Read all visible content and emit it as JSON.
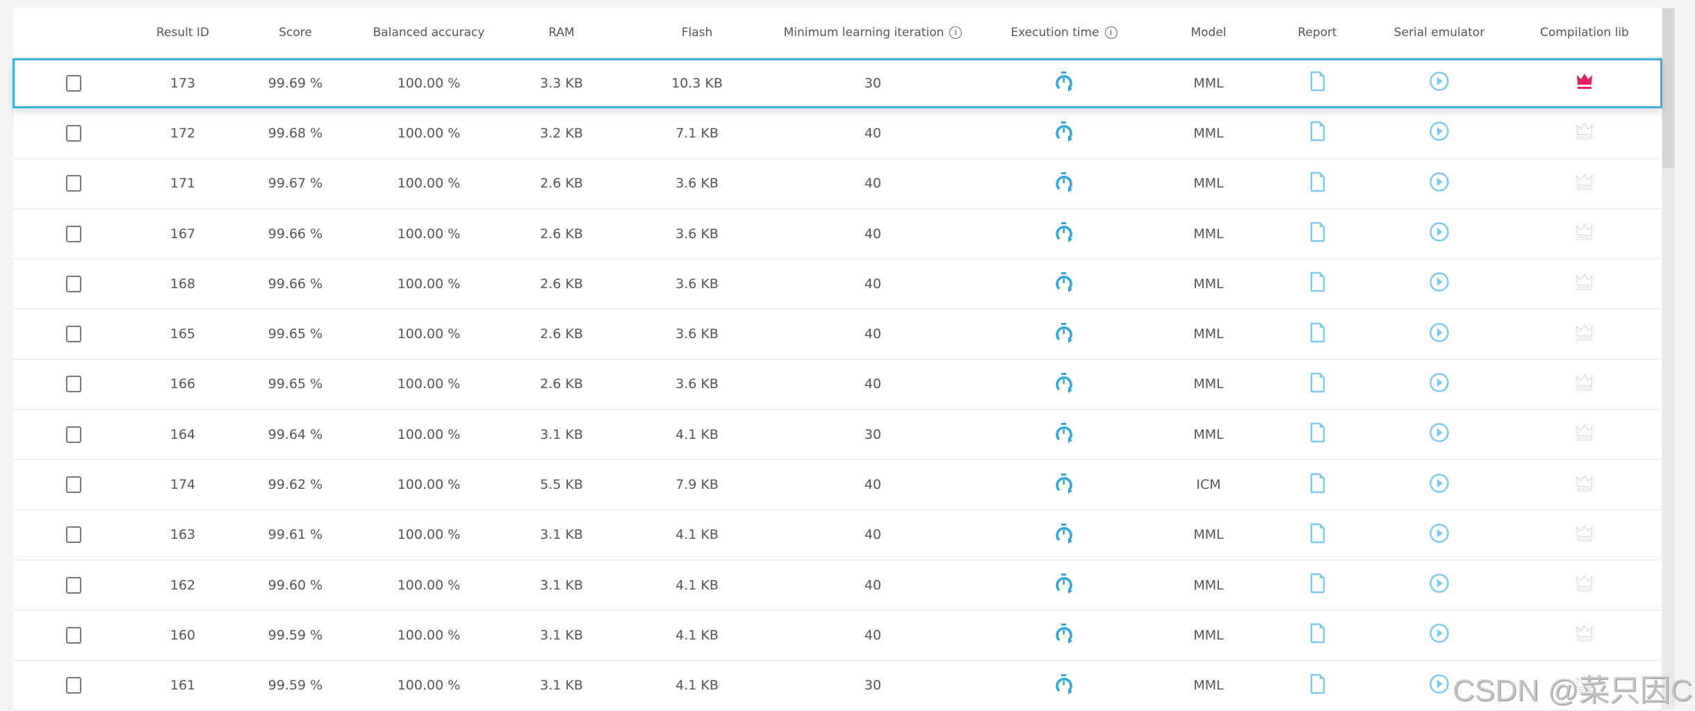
{
  "colors": {
    "accent": "#3ab0e0",
    "crown_active": "#e91e63",
    "crown_inactive": "#bbbbbb",
    "icon_blue": "#7ccbef",
    "stopwatch": "#2aa7dc"
  },
  "headers": [
    "",
    "Result ID",
    "Score",
    "Balanced accuracy",
    "RAM",
    "Flash",
    "Minimum learning iteration",
    "Execution time",
    "Model",
    "Report",
    "Serial emulator",
    "Compilation lib"
  ],
  "info_icon": "i",
  "rows": [
    {
      "id": "173",
      "score": "99.69 %",
      "bal": "100.00 %",
      "ram": "3.3 KB",
      "flash": "10.3 KB",
      "iter": "30",
      "model": "MML",
      "selected": true,
      "crown_active": true
    },
    {
      "id": "172",
      "score": "99.68 %",
      "bal": "100.00 %",
      "ram": "3.2 KB",
      "flash": "7.1 KB",
      "iter": "40",
      "model": "MML"
    },
    {
      "id": "171",
      "score": "99.67 %",
      "bal": "100.00 %",
      "ram": "2.6 KB",
      "flash": "3.6 KB",
      "iter": "40",
      "model": "MML"
    },
    {
      "id": "167",
      "score": "99.66 %",
      "bal": "100.00 %",
      "ram": "2.6 KB",
      "flash": "3.6 KB",
      "iter": "40",
      "model": "MML"
    },
    {
      "id": "168",
      "score": "99.66 %",
      "bal": "100.00 %",
      "ram": "2.6 KB",
      "flash": "3.6 KB",
      "iter": "40",
      "model": "MML"
    },
    {
      "id": "165",
      "score": "99.65 %",
      "bal": "100.00 %",
      "ram": "2.6 KB",
      "flash": "3.6 KB",
      "iter": "40",
      "model": "MML"
    },
    {
      "id": "166",
      "score": "99.65 %",
      "bal": "100.00 %",
      "ram": "2.6 KB",
      "flash": "3.6 KB",
      "iter": "40",
      "model": "MML"
    },
    {
      "id": "164",
      "score": "99.64 %",
      "bal": "100.00 %",
      "ram": "3.1 KB",
      "flash": "4.1 KB",
      "iter": "30",
      "model": "MML"
    },
    {
      "id": "174",
      "score": "99.62 %",
      "bal": "100.00 %",
      "ram": "5.5 KB",
      "flash": "7.9 KB",
      "iter": "40",
      "model": "ICM"
    },
    {
      "id": "163",
      "score": "99.61 %",
      "bal": "100.00 %",
      "ram": "3.1 KB",
      "flash": "4.1 KB",
      "iter": "40",
      "model": "MML"
    },
    {
      "id": "162",
      "score": "99.60 %",
      "bal": "100.00 %",
      "ram": "3.1 KB",
      "flash": "4.1 KB",
      "iter": "40",
      "model": "MML"
    },
    {
      "id": "160",
      "score": "99.59 %",
      "bal": "100.00 %",
      "ram": "3.1 KB",
      "flash": "4.1 KB",
      "iter": "40",
      "model": "MML"
    },
    {
      "id": "161",
      "score": "99.59 %",
      "bal": "100.00 %",
      "ram": "3.1 KB",
      "flash": "4.1 KB",
      "iter": "30",
      "model": "MML"
    }
  ],
  "watermark": "CSDN @菜只因C"
}
